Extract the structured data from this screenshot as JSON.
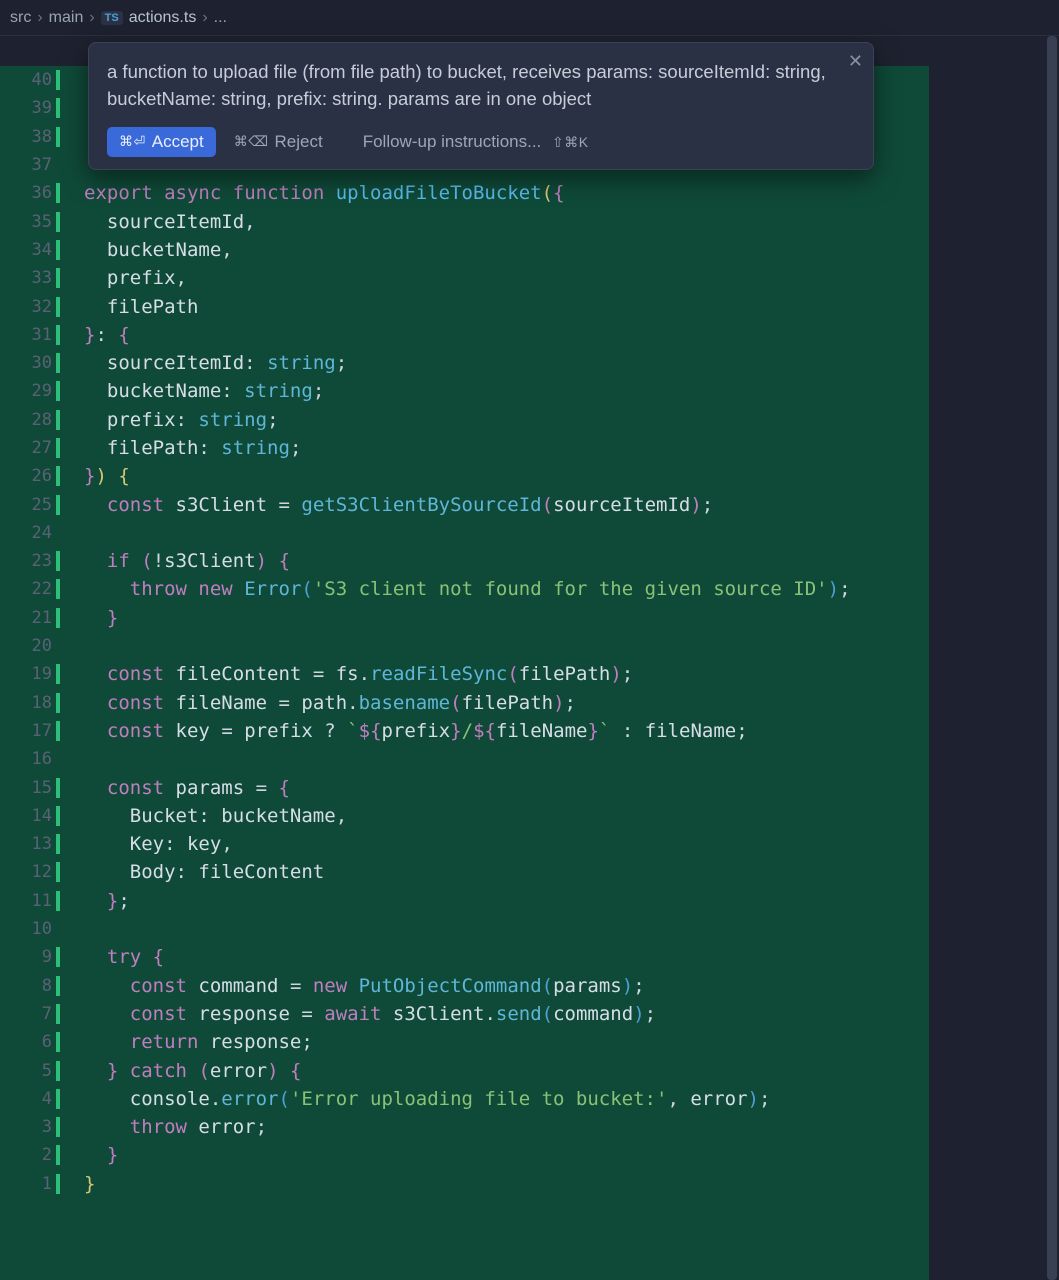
{
  "breadcrumb": {
    "seg1": "src",
    "seg2": "main",
    "ts": "TS",
    "file": "actions.ts",
    "more": "..."
  },
  "popup": {
    "prompt": "a function to upload file (from file path) to bucket, receives params: sourceItemId: string, bucketName: string, prefix: string. params are in one object",
    "accept_shortcut": "⌘⏎",
    "accept_label": "Accept",
    "reject_shortcut": "⌘⌫",
    "reject_label": "Reject",
    "followup_placeholder": "Follow-up instructions...",
    "followup_shortcut": "⇧⌘K"
  },
  "gutter_start": 40,
  "gutter_end": 1,
  "code_lines": [
    {
      "n": 40,
      "bar": true,
      "tokens": []
    },
    {
      "n": 39,
      "bar": true,
      "tokens": []
    },
    {
      "n": 38,
      "bar": true,
      "tokens": []
    },
    {
      "n": 37,
      "bar": false,
      "tokens": []
    },
    {
      "n": 36,
      "bar": true,
      "tokens": [
        {
          "c": "tk-kw",
          "t": "export"
        },
        {
          "c": "tk-punc",
          "t": " "
        },
        {
          "c": "tk-kw",
          "t": "async"
        },
        {
          "c": "tk-punc",
          "t": " "
        },
        {
          "c": "tk-kw",
          "t": "function"
        },
        {
          "c": "tk-punc",
          "t": " "
        },
        {
          "c": "tk-fn",
          "t": "uploadFileToBucket"
        },
        {
          "c": "tk-pn-y",
          "t": "("
        },
        {
          "c": "tk-pn-m",
          "t": "{"
        }
      ]
    },
    {
      "n": 35,
      "bar": true,
      "tokens": [
        {
          "c": "tk-punc",
          "t": "  "
        },
        {
          "c": "tk-id",
          "t": "sourceItemId"
        },
        {
          "c": "tk-punc",
          "t": ","
        }
      ]
    },
    {
      "n": 34,
      "bar": true,
      "tokens": [
        {
          "c": "tk-punc",
          "t": "  "
        },
        {
          "c": "tk-id",
          "t": "bucketName"
        },
        {
          "c": "tk-punc",
          "t": ","
        }
      ]
    },
    {
      "n": 33,
      "bar": true,
      "tokens": [
        {
          "c": "tk-punc",
          "t": "  "
        },
        {
          "c": "tk-id",
          "t": "prefix"
        },
        {
          "c": "tk-punc",
          "t": ","
        }
      ]
    },
    {
      "n": 32,
      "bar": true,
      "tokens": [
        {
          "c": "tk-punc",
          "t": "  "
        },
        {
          "c": "tk-id",
          "t": "filePath"
        }
      ]
    },
    {
      "n": 31,
      "bar": true,
      "tokens": [
        {
          "c": "tk-pn-m",
          "t": "}"
        },
        {
          "c": "tk-punc",
          "t": ": "
        },
        {
          "c": "tk-pn-m",
          "t": "{"
        }
      ]
    },
    {
      "n": 30,
      "bar": true,
      "tokens": [
        {
          "c": "tk-punc",
          "t": "  "
        },
        {
          "c": "tk-id",
          "t": "sourceItemId"
        },
        {
          "c": "tk-punc",
          "t": ": "
        },
        {
          "c": "tk-type",
          "t": "string"
        },
        {
          "c": "tk-punc",
          "t": ";"
        }
      ]
    },
    {
      "n": 29,
      "bar": true,
      "tokens": [
        {
          "c": "tk-punc",
          "t": "  "
        },
        {
          "c": "tk-id",
          "t": "bucketName"
        },
        {
          "c": "tk-punc",
          "t": ": "
        },
        {
          "c": "tk-type",
          "t": "string"
        },
        {
          "c": "tk-punc",
          "t": ";"
        }
      ]
    },
    {
      "n": 28,
      "bar": true,
      "tokens": [
        {
          "c": "tk-punc",
          "t": "  "
        },
        {
          "c": "tk-id",
          "t": "prefix"
        },
        {
          "c": "tk-punc",
          "t": ": "
        },
        {
          "c": "tk-type",
          "t": "string"
        },
        {
          "c": "tk-punc",
          "t": ";"
        }
      ]
    },
    {
      "n": 27,
      "bar": true,
      "tokens": [
        {
          "c": "tk-punc",
          "t": "  "
        },
        {
          "c": "tk-id",
          "t": "filePath"
        },
        {
          "c": "tk-punc",
          "t": ": "
        },
        {
          "c": "tk-type",
          "t": "string"
        },
        {
          "c": "tk-punc",
          "t": ";"
        }
      ]
    },
    {
      "n": 26,
      "bar": true,
      "tokens": [
        {
          "c": "tk-pn-m",
          "t": "}"
        },
        {
          "c": "tk-pn-y",
          "t": ")"
        },
        {
          "c": "tk-punc",
          "t": " "
        },
        {
          "c": "tk-pn-y",
          "t": "{"
        }
      ]
    },
    {
      "n": 25,
      "bar": true,
      "tokens": [
        {
          "c": "tk-punc",
          "t": "  "
        },
        {
          "c": "tk-kw",
          "t": "const"
        },
        {
          "c": "tk-punc",
          "t": " "
        },
        {
          "c": "tk-id",
          "t": "s3Client"
        },
        {
          "c": "tk-punc",
          "t": " = "
        },
        {
          "c": "tk-call",
          "t": "getS3ClientBySourceId"
        },
        {
          "c": "tk-pn-m",
          "t": "("
        },
        {
          "c": "tk-id",
          "t": "sourceItemId"
        },
        {
          "c": "tk-pn-m",
          "t": ")"
        },
        {
          "c": "tk-punc",
          "t": ";"
        }
      ]
    },
    {
      "n": 24,
      "bar": false,
      "tokens": []
    },
    {
      "n": 23,
      "bar": true,
      "tokens": [
        {
          "c": "tk-punc",
          "t": "  "
        },
        {
          "c": "tk-kw",
          "t": "if"
        },
        {
          "c": "tk-punc",
          "t": " "
        },
        {
          "c": "tk-pn-m",
          "t": "("
        },
        {
          "c": "tk-punc",
          "t": "!"
        },
        {
          "c": "tk-id",
          "t": "s3Client"
        },
        {
          "c": "tk-pn-m",
          "t": ")"
        },
        {
          "c": "tk-punc",
          "t": " "
        },
        {
          "c": "tk-pn-m",
          "t": "{"
        }
      ]
    },
    {
      "n": 22,
      "bar": true,
      "tokens": [
        {
          "c": "tk-punc",
          "t": "    "
        },
        {
          "c": "tk-kw",
          "t": "throw"
        },
        {
          "c": "tk-punc",
          "t": " "
        },
        {
          "c": "tk-kw",
          "t": "new"
        },
        {
          "c": "tk-punc",
          "t": " "
        },
        {
          "c": "tk-call",
          "t": "Error"
        },
        {
          "c": "tk-pn-b",
          "t": "("
        },
        {
          "c": "tk-str",
          "t": "'S3 client not found for the given source ID'"
        },
        {
          "c": "tk-pn-b",
          "t": ")"
        },
        {
          "c": "tk-punc",
          "t": ";"
        }
      ]
    },
    {
      "n": 21,
      "bar": true,
      "tokens": [
        {
          "c": "tk-punc",
          "t": "  "
        },
        {
          "c": "tk-pn-m",
          "t": "}"
        }
      ]
    },
    {
      "n": 20,
      "bar": false,
      "tokens": []
    },
    {
      "n": 19,
      "bar": true,
      "tokens": [
        {
          "c": "tk-punc",
          "t": "  "
        },
        {
          "c": "tk-kw",
          "t": "const"
        },
        {
          "c": "tk-punc",
          "t": " "
        },
        {
          "c": "tk-id",
          "t": "fileContent"
        },
        {
          "c": "tk-punc",
          "t": " = "
        },
        {
          "c": "tk-id",
          "t": "fs"
        },
        {
          "c": "tk-punc",
          "t": "."
        },
        {
          "c": "tk-call",
          "t": "readFileSync"
        },
        {
          "c": "tk-pn-m",
          "t": "("
        },
        {
          "c": "tk-id",
          "t": "filePath"
        },
        {
          "c": "tk-pn-m",
          "t": ")"
        },
        {
          "c": "tk-punc",
          "t": ";"
        }
      ]
    },
    {
      "n": 18,
      "bar": true,
      "tokens": [
        {
          "c": "tk-punc",
          "t": "  "
        },
        {
          "c": "tk-kw",
          "t": "const"
        },
        {
          "c": "tk-punc",
          "t": " "
        },
        {
          "c": "tk-id",
          "t": "fileName"
        },
        {
          "c": "tk-punc",
          "t": " = "
        },
        {
          "c": "tk-id",
          "t": "path"
        },
        {
          "c": "tk-punc",
          "t": "."
        },
        {
          "c": "tk-call",
          "t": "basename"
        },
        {
          "c": "tk-pn-m",
          "t": "("
        },
        {
          "c": "tk-id",
          "t": "filePath"
        },
        {
          "c": "tk-pn-m",
          "t": ")"
        },
        {
          "c": "tk-punc",
          "t": ";"
        }
      ]
    },
    {
      "n": 17,
      "bar": true,
      "tokens": [
        {
          "c": "tk-punc",
          "t": "  "
        },
        {
          "c": "tk-kw",
          "t": "const"
        },
        {
          "c": "tk-punc",
          "t": " "
        },
        {
          "c": "tk-id",
          "t": "key"
        },
        {
          "c": "tk-punc",
          "t": " = "
        },
        {
          "c": "tk-id",
          "t": "prefix"
        },
        {
          "c": "tk-punc",
          "t": " ? "
        },
        {
          "c": "tk-tpl",
          "t": "`"
        },
        {
          "c": "tk-pn-m",
          "t": "${"
        },
        {
          "c": "tk-id",
          "t": "prefix"
        },
        {
          "c": "tk-pn-m",
          "t": "}"
        },
        {
          "c": "tk-tpl",
          "t": "/"
        },
        {
          "c": "tk-pn-m",
          "t": "${"
        },
        {
          "c": "tk-id",
          "t": "fileName"
        },
        {
          "c": "tk-pn-m",
          "t": "}"
        },
        {
          "c": "tk-tpl",
          "t": "`"
        },
        {
          "c": "tk-punc",
          "t": " : "
        },
        {
          "c": "tk-id",
          "t": "fileName"
        },
        {
          "c": "tk-punc",
          "t": ";"
        }
      ]
    },
    {
      "n": 16,
      "bar": false,
      "tokens": []
    },
    {
      "n": 15,
      "bar": true,
      "tokens": [
        {
          "c": "tk-punc",
          "t": "  "
        },
        {
          "c": "tk-kw",
          "t": "const"
        },
        {
          "c": "tk-punc",
          "t": " "
        },
        {
          "c": "tk-id",
          "t": "params"
        },
        {
          "c": "tk-punc",
          "t": " = "
        },
        {
          "c": "tk-pn-m",
          "t": "{"
        }
      ]
    },
    {
      "n": 14,
      "bar": true,
      "tokens": [
        {
          "c": "tk-punc",
          "t": "    "
        },
        {
          "c": "tk-prop",
          "t": "Bucket"
        },
        {
          "c": "tk-punc",
          "t": ": "
        },
        {
          "c": "tk-id",
          "t": "bucketName"
        },
        {
          "c": "tk-punc",
          "t": ","
        }
      ]
    },
    {
      "n": 13,
      "bar": true,
      "tokens": [
        {
          "c": "tk-punc",
          "t": "    "
        },
        {
          "c": "tk-prop",
          "t": "Key"
        },
        {
          "c": "tk-punc",
          "t": ": "
        },
        {
          "c": "tk-id",
          "t": "key"
        },
        {
          "c": "tk-punc",
          "t": ","
        }
      ]
    },
    {
      "n": 12,
      "bar": true,
      "tokens": [
        {
          "c": "tk-punc",
          "t": "    "
        },
        {
          "c": "tk-prop",
          "t": "Body"
        },
        {
          "c": "tk-punc",
          "t": ": "
        },
        {
          "c": "tk-id",
          "t": "fileContent"
        }
      ]
    },
    {
      "n": 11,
      "bar": true,
      "tokens": [
        {
          "c": "tk-punc",
          "t": "  "
        },
        {
          "c": "tk-pn-m",
          "t": "}"
        },
        {
          "c": "tk-punc",
          "t": ";"
        }
      ]
    },
    {
      "n": 10,
      "bar": false,
      "tokens": []
    },
    {
      "n": 9,
      "bar": true,
      "tokens": [
        {
          "c": "tk-punc",
          "t": "  "
        },
        {
          "c": "tk-kw",
          "t": "try"
        },
        {
          "c": "tk-punc",
          "t": " "
        },
        {
          "c": "tk-pn-m",
          "t": "{"
        }
      ]
    },
    {
      "n": 8,
      "bar": true,
      "tokens": [
        {
          "c": "tk-punc",
          "t": "    "
        },
        {
          "c": "tk-kw",
          "t": "const"
        },
        {
          "c": "tk-punc",
          "t": " "
        },
        {
          "c": "tk-id",
          "t": "command"
        },
        {
          "c": "tk-punc",
          "t": " = "
        },
        {
          "c": "tk-kw",
          "t": "new"
        },
        {
          "c": "tk-punc",
          "t": " "
        },
        {
          "c": "tk-call",
          "t": "PutObjectCommand"
        },
        {
          "c": "tk-pn-b",
          "t": "("
        },
        {
          "c": "tk-id",
          "t": "params"
        },
        {
          "c": "tk-pn-b",
          "t": ")"
        },
        {
          "c": "tk-punc",
          "t": ";"
        }
      ]
    },
    {
      "n": 7,
      "bar": true,
      "tokens": [
        {
          "c": "tk-punc",
          "t": "    "
        },
        {
          "c": "tk-kw",
          "t": "const"
        },
        {
          "c": "tk-punc",
          "t": " "
        },
        {
          "c": "tk-id",
          "t": "response"
        },
        {
          "c": "tk-punc",
          "t": " = "
        },
        {
          "c": "tk-kw",
          "t": "await"
        },
        {
          "c": "tk-punc",
          "t": " "
        },
        {
          "c": "tk-id",
          "t": "s3Client"
        },
        {
          "c": "tk-punc",
          "t": "."
        },
        {
          "c": "tk-call",
          "t": "send"
        },
        {
          "c": "tk-pn-b",
          "t": "("
        },
        {
          "c": "tk-id",
          "t": "command"
        },
        {
          "c": "tk-pn-b",
          "t": ")"
        },
        {
          "c": "tk-punc",
          "t": ";"
        }
      ]
    },
    {
      "n": 6,
      "bar": true,
      "tokens": [
        {
          "c": "tk-punc",
          "t": "    "
        },
        {
          "c": "tk-kw",
          "t": "return"
        },
        {
          "c": "tk-punc",
          "t": " "
        },
        {
          "c": "tk-id",
          "t": "response"
        },
        {
          "c": "tk-punc",
          "t": ";"
        }
      ]
    },
    {
      "n": 5,
      "bar": true,
      "tokens": [
        {
          "c": "tk-punc",
          "t": "  "
        },
        {
          "c": "tk-pn-m",
          "t": "}"
        },
        {
          "c": "tk-punc",
          "t": " "
        },
        {
          "c": "tk-kw",
          "t": "catch"
        },
        {
          "c": "tk-punc",
          "t": " "
        },
        {
          "c": "tk-pn-m",
          "t": "("
        },
        {
          "c": "tk-id",
          "t": "error"
        },
        {
          "c": "tk-pn-m",
          "t": ")"
        },
        {
          "c": "tk-punc",
          "t": " "
        },
        {
          "c": "tk-pn-m",
          "t": "{"
        }
      ]
    },
    {
      "n": 4,
      "bar": true,
      "tokens": [
        {
          "c": "tk-punc",
          "t": "    "
        },
        {
          "c": "tk-id",
          "t": "console"
        },
        {
          "c": "tk-punc",
          "t": "."
        },
        {
          "c": "tk-call",
          "t": "error"
        },
        {
          "c": "tk-pn-b",
          "t": "("
        },
        {
          "c": "tk-str",
          "t": "'Error uploading file to bucket:'"
        },
        {
          "c": "tk-punc",
          "t": ", "
        },
        {
          "c": "tk-id",
          "t": "error"
        },
        {
          "c": "tk-pn-b",
          "t": ")"
        },
        {
          "c": "tk-punc",
          "t": ";"
        }
      ]
    },
    {
      "n": 3,
      "bar": true,
      "tokens": [
        {
          "c": "tk-punc",
          "t": "    "
        },
        {
          "c": "tk-kw",
          "t": "throw"
        },
        {
          "c": "tk-punc",
          "t": " "
        },
        {
          "c": "tk-id",
          "t": "error"
        },
        {
          "c": "tk-punc",
          "t": ";"
        }
      ]
    },
    {
      "n": 2,
      "bar": true,
      "tokens": [
        {
          "c": "tk-punc",
          "t": "  "
        },
        {
          "c": "tk-pn-m",
          "t": "}"
        }
      ]
    },
    {
      "n": 1,
      "bar": true,
      "tokens": [
        {
          "c": "tk-pn-y",
          "t": "}"
        }
      ]
    }
  ]
}
